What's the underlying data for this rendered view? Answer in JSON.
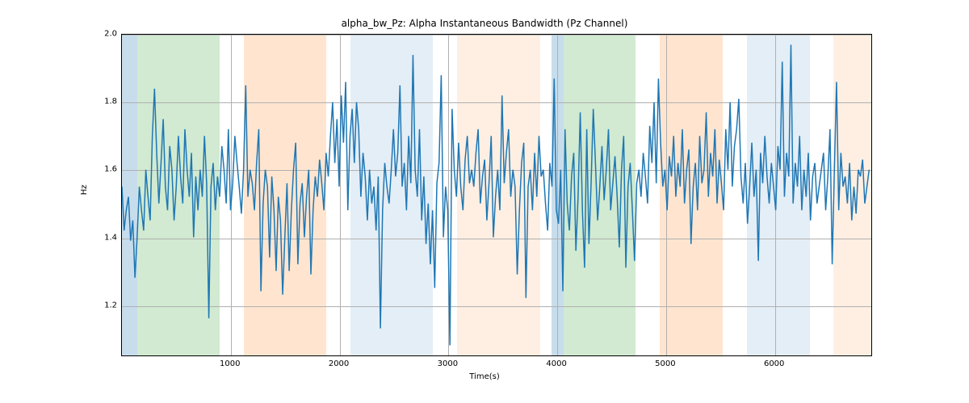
{
  "chart_data": {
    "type": "line",
    "title": "alpha_bw_Pz: Alpha Instantaneous Bandwidth (Pz Channel)",
    "xlabel": "Time(s)",
    "ylabel": "Hz",
    "xlim": [
      0,
      6900
    ],
    "ylim": [
      1.05,
      2.0
    ],
    "xticks": [
      1000,
      2000,
      3000,
      4000,
      5000,
      6000
    ],
    "yticks": [
      1.2,
      1.4,
      1.6,
      1.8,
      2.0
    ],
    "grid": true,
    "line_color": "#1f77b4",
    "bands": [
      {
        "start": 0,
        "end": 140,
        "color": "blue"
      },
      {
        "start": 140,
        "end": 900,
        "color": "green"
      },
      {
        "start": 1120,
        "end": 1880,
        "color": "orange"
      },
      {
        "start": 2100,
        "end": 2860,
        "color": "lightblue"
      },
      {
        "start": 3080,
        "end": 3840,
        "color": "lightorange"
      },
      {
        "start": 3950,
        "end": 4060,
        "color": "blue"
      },
      {
        "start": 4060,
        "end": 4720,
        "color": "green"
      },
      {
        "start": 4940,
        "end": 5520,
        "color": "orange"
      },
      {
        "start": 5740,
        "end": 6320,
        "color": "lightblue"
      },
      {
        "start": 6540,
        "end": 6900,
        "color": "lightorange"
      }
    ],
    "x": [
      0,
      20,
      40,
      60,
      80,
      100,
      120,
      140,
      160,
      180,
      200,
      220,
      240,
      260,
      280,
      300,
      320,
      340,
      360,
      380,
      400,
      420,
      440,
      460,
      480,
      500,
      520,
      540,
      560,
      580,
      600,
      620,
      640,
      660,
      680,
      700,
      720,
      740,
      760,
      780,
      800,
      820,
      840,
      860,
      880,
      900,
      920,
      940,
      960,
      980,
      1000,
      1020,
      1040,
      1060,
      1080,
      1100,
      1120,
      1140,
      1160,
      1180,
      1200,
      1220,
      1240,
      1260,
      1280,
      1300,
      1320,
      1340,
      1360,
      1380,
      1400,
      1420,
      1440,
      1460,
      1480,
      1500,
      1520,
      1540,
      1560,
      1580,
      1600,
      1620,
      1640,
      1660,
      1680,
      1700,
      1720,
      1740,
      1760,
      1780,
      1800,
      1820,
      1840,
      1860,
      1880,
      1900,
      1920,
      1940,
      1960,
      1980,
      2000,
      2020,
      2040,
      2060,
      2080,
      2100,
      2120,
      2140,
      2160,
      2180,
      2200,
      2220,
      2240,
      2260,
      2280,
      2300,
      2320,
      2340,
      2360,
      2380,
      2400,
      2420,
      2440,
      2460,
      2480,
      2500,
      2520,
      2540,
      2560,
      2580,
      2600,
      2620,
      2640,
      2660,
      2680,
      2700,
      2720,
      2740,
      2760,
      2780,
      2800,
      2820,
      2840,
      2860,
      2880,
      2900,
      2920,
      2940,
      2960,
      2980,
      3000,
      3020,
      3040,
      3060,
      3080,
      3100,
      3120,
      3140,
      3160,
      3180,
      3200,
      3220,
      3240,
      3260,
      3280,
      3300,
      3320,
      3340,
      3360,
      3380,
      3400,
      3420,
      3440,
      3460,
      3480,
      3500,
      3520,
      3540,
      3560,
      3580,
      3600,
      3620,
      3640,
      3660,
      3680,
      3700,
      3720,
      3740,
      3760,
      3780,
      3800,
      3820,
      3840,
      3860,
      3880,
      3900,
      3920,
      3940,
      3960,
      3980,
      4000,
      4020,
      4040,
      4060,
      4080,
      4100,
      4120,
      4140,
      4160,
      4180,
      4200,
      4220,
      4240,
      4260,
      4280,
      4300,
      4320,
      4340,
      4360,
      4380,
      4400,
      4420,
      4440,
      4460,
      4480,
      4500,
      4520,
      4540,
      4560,
      4580,
      4600,
      4620,
      4640,
      4660,
      4680,
      4700,
      4720,
      4740,
      4760,
      4780,
      4800,
      4820,
      4840,
      4860,
      4880,
      4900,
      4920,
      4940,
      4960,
      4980,
      5000,
      5020,
      5040,
      5060,
      5080,
      5100,
      5120,
      5140,
      5160,
      5180,
      5200,
      5220,
      5240,
      5260,
      5280,
      5300,
      5320,
      5340,
      5360,
      5380,
      5400,
      5420,
      5440,
      5460,
      5480,
      5500,
      5520,
      5540,
      5560,
      5580,
      5600,
      5620,
      5640,
      5660,
      5680,
      5700,
      5720,
      5740,
      5760,
      5780,
      5800,
      5820,
      5840,
      5860,
      5880,
      5900,
      5920,
      5940,
      5960,
      5980,
      6000,
      6020,
      6040,
      6060,
      6080,
      6100,
      6120,
      6140,
      6160,
      6180,
      6200,
      6220,
      6240,
      6260,
      6280,
      6300,
      6320,
      6340,
      6360,
      6380,
      6400,
      6420,
      6440,
      6460,
      6480,
      6500,
      6520,
      6540,
      6560,
      6580,
      6600,
      6620,
      6640,
      6660,
      6680,
      6700,
      6720,
      6740,
      6760,
      6780,
      6800,
      6820,
      6840,
      6860,
      6880,
      6900
    ],
    "values": [
      1.55,
      1.42,
      1.48,
      1.52,
      1.39,
      1.45,
      1.28,
      1.4,
      1.55,
      1.48,
      1.42,
      1.6,
      1.52,
      1.45,
      1.7,
      1.84,
      1.65,
      1.5,
      1.62,
      1.75,
      1.55,
      1.48,
      1.67,
      1.6,
      1.45,
      1.55,
      1.7,
      1.58,
      1.5,
      1.72,
      1.6,
      1.52,
      1.65,
      1.4,
      1.58,
      1.48,
      1.6,
      1.52,
      1.7,
      1.56,
      1.16,
      1.55,
      1.62,
      1.48,
      1.58,
      1.52,
      1.67,
      1.6,
      1.5,
      1.72,
      1.48,
      1.56,
      1.7,
      1.62,
      1.55,
      1.47,
      1.6,
      1.85,
      1.52,
      1.6,
      1.56,
      1.48,
      1.62,
      1.72,
      1.24,
      1.5,
      1.6,
      1.55,
      1.34,
      1.58,
      1.48,
      1.3,
      1.52,
      1.45,
      1.23,
      1.4,
      1.56,
      1.3,
      1.48,
      1.6,
      1.68,
      1.32,
      1.5,
      1.56,
      1.4,
      1.52,
      1.6,
      1.29,
      1.48,
      1.58,
      1.52,
      1.63,
      1.56,
      1.48,
      1.65,
      1.58,
      1.7,
      1.8,
      1.62,
      1.75,
      1.55,
      1.82,
      1.68,
      1.86,
      1.48,
      1.7,
      1.78,
      1.62,
      1.8,
      1.72,
      1.52,
      1.65,
      1.58,
      1.45,
      1.6,
      1.5,
      1.55,
      1.42,
      1.58,
      1.13,
      1.48,
      1.62,
      1.55,
      1.5,
      1.6,
      1.72,
      1.58,
      1.65,
      1.85,
      1.55,
      1.62,
      1.48,
      1.7,
      1.56,
      1.94,
      1.6,
      1.52,
      1.72,
      1.45,
      1.58,
      1.38,
      1.5,
      1.32,
      1.48,
      1.25,
      1.56,
      1.62,
      1.88,
      1.4,
      1.55,
      1.48,
      1.08,
      1.78,
      1.6,
      1.52,
      1.68,
      1.55,
      1.48,
      1.63,
      1.7,
      1.56,
      1.6,
      1.55,
      1.65,
      1.72,
      1.5,
      1.58,
      1.63,
      1.45,
      1.56,
      1.7,
      1.4,
      1.52,
      1.6,
      1.48,
      1.82,
      1.56,
      1.65,
      1.72,
      1.52,
      1.6,
      1.55,
      1.29,
      1.48,
      1.62,
      1.68,
      1.22,
      1.55,
      1.6,
      1.48,
      1.65,
      1.52,
      1.7,
      1.58,
      1.6,
      1.5,
      1.42,
      1.62,
      1.55,
      1.87,
      1.48,
      1.44,
      1.6,
      1.24,
      1.72,
      1.5,
      1.42,
      1.58,
      1.65,
      1.36,
      1.52,
      1.77,
      1.48,
      1.31,
      1.72,
      1.38,
      1.56,
      1.78,
      1.62,
      1.45,
      1.55,
      1.67,
      1.51,
      1.6,
      1.72,
      1.48,
      1.56,
      1.64,
      1.52,
      1.37,
      1.6,
      1.7,
      1.31,
      1.55,
      1.62,
      1.48,
      1.33,
      1.56,
      1.6,
      1.52,
      1.65,
      1.58,
      1.5,
      1.73,
      1.62,
      1.8,
      1.56,
      1.87,
      1.68,
      1.55,
      1.6,
      1.48,
      1.64,
      1.58,
      1.7,
      1.52,
      1.62,
      1.55,
      1.72,
      1.5,
      1.6,
      1.66,
      1.38,
      1.55,
      1.62,
      1.48,
      1.7,
      1.56,
      1.6,
      1.77,
      1.52,
      1.65,
      1.58,
      1.72,
      1.5,
      1.63,
      1.56,
      1.48,
      1.72,
      1.6,
      1.8,
      1.55,
      1.67,
      1.72,
      1.81,
      1.58,
      1.5,
      1.62,
      1.44,
      1.55,
      1.68,
      1.52,
      1.6,
      1.33,
      1.65,
      1.56,
      1.7,
      1.58,
      1.5,
      1.62,
      1.55,
      1.48,
      1.67,
      1.6,
      1.92,
      1.52,
      1.65,
      1.58,
      1.97,
      1.5,
      1.62,
      1.55,
      1.7,
      1.48,
      1.6,
      1.52,
      1.65,
      1.45,
      1.58,
      1.62,
      1.5,
      1.55,
      1.6,
      1.65,
      1.48,
      1.58,
      1.72,
      1.32,
      1.6,
      1.86,
      1.48,
      1.65,
      1.55,
      1.58,
      1.5,
      1.62,
      1.45,
      1.55,
      1.47,
      1.6,
      1.58,
      1.63,
      1.5,
      1.55,
      1.6
    ]
  }
}
